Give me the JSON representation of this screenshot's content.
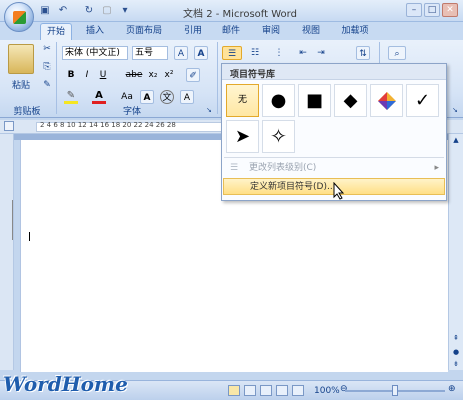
{
  "window": {
    "title": "文档 2 - Microsoft Word"
  },
  "tabs": [
    {
      "label": "开始",
      "active": true
    },
    {
      "label": "插入"
    },
    {
      "label": "页面布局"
    },
    {
      "label": "引用"
    },
    {
      "label": "邮件"
    },
    {
      "label": "审阅"
    },
    {
      "label": "视图"
    },
    {
      "label": "加载项"
    }
  ],
  "clipboard": {
    "paste_label": "粘贴",
    "group_label": "剪贴板"
  },
  "font": {
    "name": "宋体 (中文正)",
    "size": "五号",
    "group_label": "字体",
    "bold": "B",
    "italic": "I",
    "underline": "U",
    "strike": "abe",
    "sub": "x₂",
    "sup": "x²",
    "grow": "A",
    "aa": "Aa",
    "a_box": "A",
    "wen": "文"
  },
  "bullet_menu": {
    "header": "项目符号库",
    "none_label": "无",
    "symbols": [
      "●",
      "■",
      "◆",
      "✓"
    ],
    "arrow_symbol": "➤",
    "star_symbol": "✧",
    "change_level": "更改列表级别(C)",
    "define_new": "定义新项目符号(D)..."
  },
  "ruler": {
    "ticks": "2  4  6  8  10  12  14  16  18  20  22  24  26  28"
  },
  "status": {
    "zoom": "100%"
  },
  "watermark": "WordHome",
  "colors": {
    "accent": "#15428b",
    "hover": "#ffdf86",
    "highlight_yellow": "#f5e623",
    "font_red": "#e02020"
  }
}
